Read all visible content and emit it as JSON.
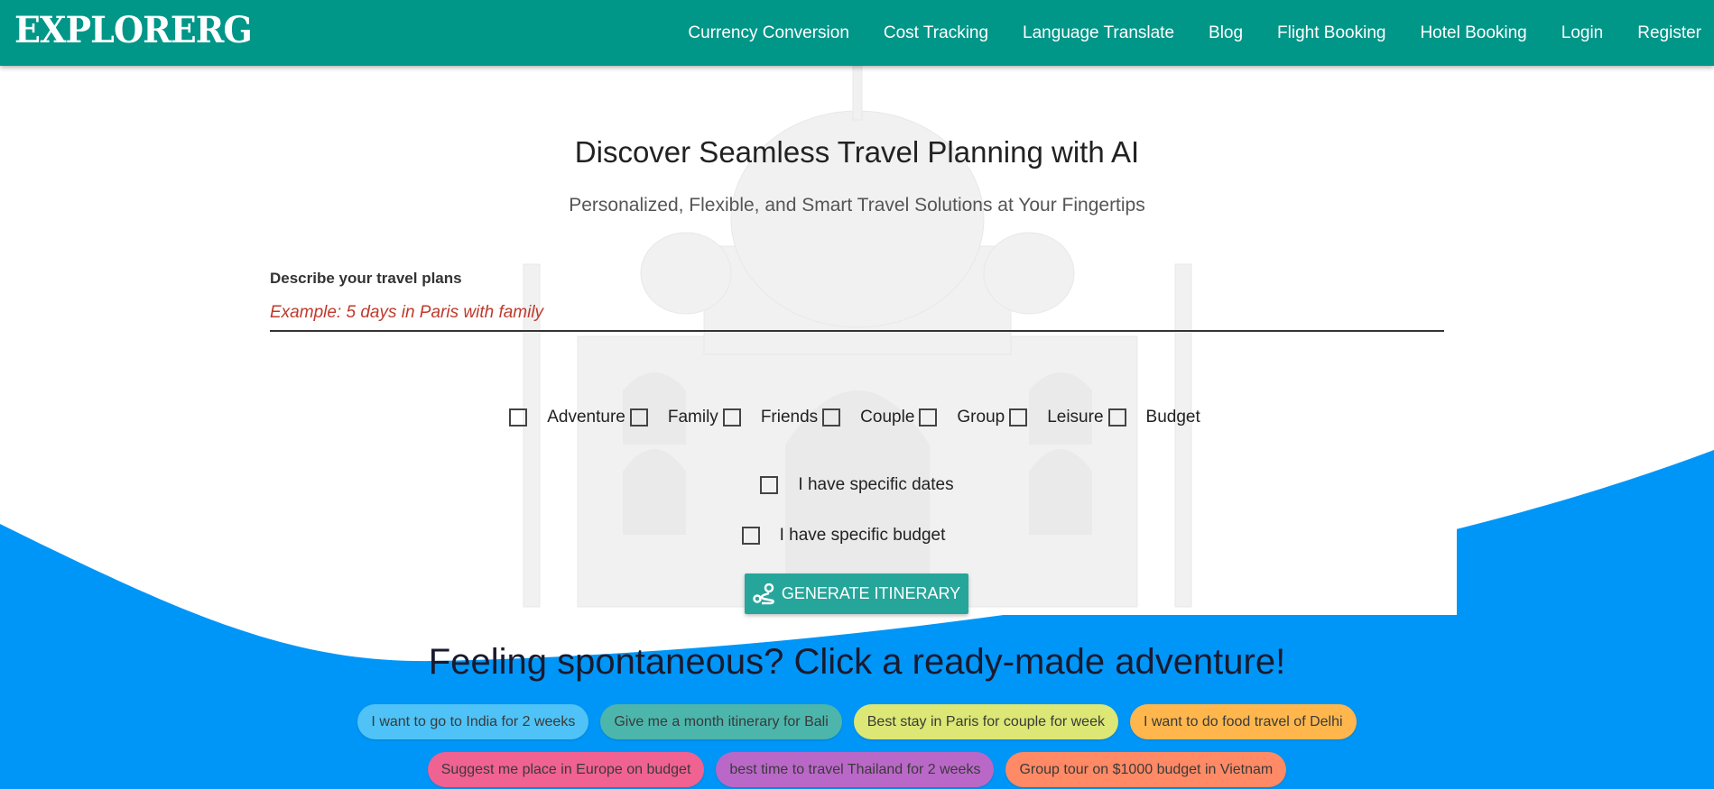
{
  "brand": {
    "logo": "EXPLORERG",
    "nav_color": "#009688"
  },
  "nav": {
    "items": [
      "Currency Conversion",
      "Cost Tracking",
      "Language Translate",
      "Blog",
      "Flight Booking",
      "Hotel Booking",
      "Login",
      "Register"
    ]
  },
  "hero": {
    "title": "Discover Seamless Travel Planning with AI",
    "subtitle": "Personalized, Flexible, and Smart Travel Solutions at Your Fingertips",
    "plans_label": "Describe your travel plans",
    "plans_placeholder": "Example: 5 days in Paris with family",
    "plans_value": "",
    "trip_types": [
      {
        "label": "Adventure",
        "checked": false
      },
      {
        "label": "Family",
        "checked": false
      },
      {
        "label": "Friends",
        "checked": false
      },
      {
        "label": "Couple",
        "checked": false
      },
      {
        "label": "Group",
        "checked": false
      },
      {
        "label": "Leisure",
        "checked": false
      },
      {
        "label": "Budget",
        "checked": false
      }
    ],
    "specific_dates": {
      "label": "I have specific dates",
      "checked": false
    },
    "specific_budget": {
      "label": "I have specific budget",
      "checked": false
    },
    "generate_button": {
      "label": "GENERATE ITINERARY",
      "icon": "route-icon",
      "color": "#26a69a"
    }
  },
  "spontaneous": {
    "title": "Feeling spontaneous? Click a ready-made adventure!",
    "background": "#0096f7",
    "chips": [
      {
        "label": "I want to go to India for 2 weeks",
        "color": "#4fc3f7"
      },
      {
        "label": "Give me a month itinerary for Bali",
        "color": "#4db6ac"
      },
      {
        "label": "Best stay in Paris for couple for week",
        "color": "#dce775"
      },
      {
        "label": "I want to do food travel of Delhi",
        "color": "#ffb74d"
      },
      {
        "label": "Suggest me place in Europe on budget",
        "color": "#f06292"
      },
      {
        "label": "best time to travel Thailand for 2 weeks",
        "color": "#ba68c8"
      },
      {
        "label": "Group tour on $1000 budget in Vietnam",
        "color": "#ff8a65"
      }
    ]
  }
}
